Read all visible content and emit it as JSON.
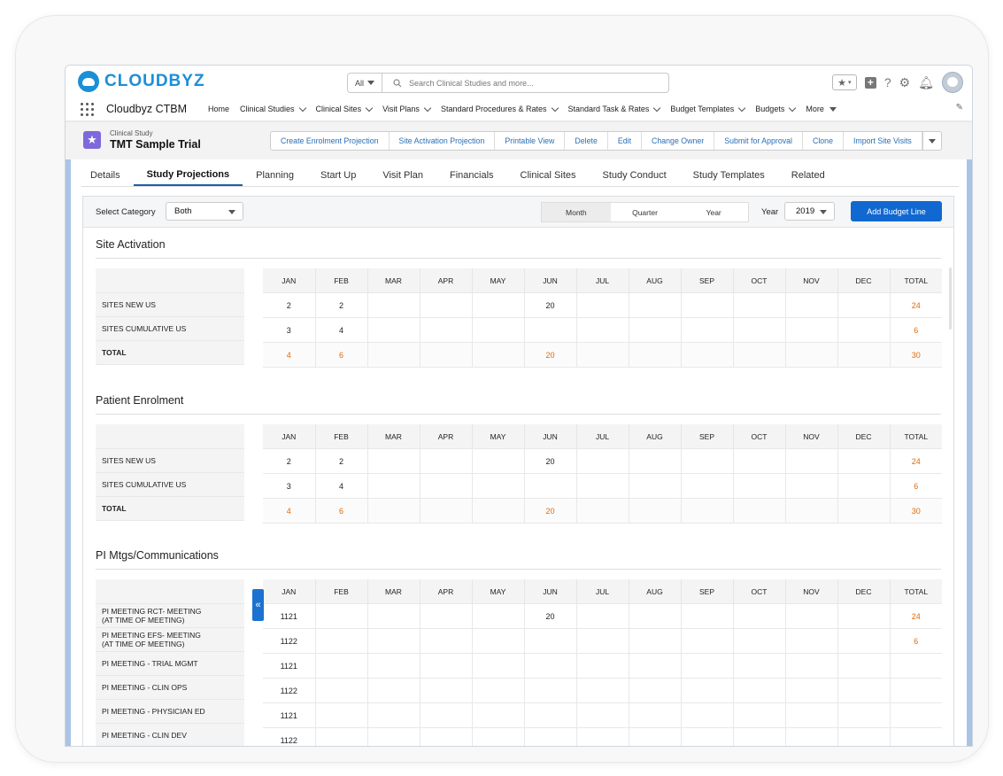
{
  "header": {
    "logo_text": "CLOUDBYZ",
    "search_scope": "All",
    "search_placeholder": "Search Clinical Studies and more..."
  },
  "nav": {
    "app_name": "Cloudbyz CTBM",
    "items": [
      "Home",
      "Clinical Studies",
      "Clinical Sites",
      "Visit Plans",
      "Standard Procedures & Rates",
      "Standard Task & Rates",
      "Budget Templates",
      "Budgets",
      "More"
    ]
  },
  "record": {
    "type": "Clinical Study",
    "name": "TMT Sample Trial",
    "actions": [
      "Create Enrolment Projection",
      "Site Activation Projection",
      "Printable View",
      "Delete",
      "Edit",
      "Change Owner",
      "Submit for Approval",
      "Clone",
      "Import Site Visits"
    ]
  },
  "tabs": [
    "Details",
    "Study Projections",
    "Planning",
    "Start Up",
    "Visit Plan",
    "Financials",
    "Clinical Sites",
    "Study Conduct",
    "Study Templates",
    "Related"
  ],
  "filters": {
    "category_label": "Select Category",
    "category_value": "Both",
    "periods": [
      "Month",
      "Quarter",
      "Year"
    ],
    "year_label": "Year",
    "year_value": "2019",
    "add_button": "Add Budget Line"
  },
  "columns": [
    "JAN",
    "FEB",
    "MAR",
    "APR",
    "MAY",
    "JUN",
    "JUL",
    "AUG",
    "SEP",
    "OCT",
    "NOV",
    "DEC",
    "TOTAL"
  ],
  "sections": [
    {
      "title": "Site Activation",
      "rows": [
        {
          "label": "SITES NEW US",
          "values": [
            "2",
            "2",
            "",
            "",
            "",
            "20",
            "",
            "",
            "",
            "",
            "",
            "",
            "24"
          ]
        },
        {
          "label": "SITES CUMULATIVE US",
          "values": [
            "3",
            "4",
            "",
            "",
            "",
            "",
            "",
            "",
            "",
            "",
            "",
            "",
            "6"
          ]
        },
        {
          "label": "TOTAL",
          "values": [
            "4",
            "6",
            "",
            "",
            "",
            "20",
            "",
            "",
            "",
            "",
            "",
            "",
            "30"
          ]
        }
      ]
    },
    {
      "title": "Patient Enrolment",
      "rows": [
        {
          "label": "SITES NEW US",
          "values": [
            "2",
            "2",
            "",
            "",
            "",
            "20",
            "",
            "",
            "",
            "",
            "",
            "",
            "24"
          ]
        },
        {
          "label": "SITES CUMULATIVE US",
          "values": [
            "3",
            "4",
            "",
            "",
            "",
            "",
            "",
            "",
            "",
            "",
            "",
            "",
            "6"
          ]
        },
        {
          "label": "TOTAL",
          "values": [
            "4",
            "6",
            "",
            "",
            "",
            "20",
            "",
            "",
            "",
            "",
            "",
            "",
            "30"
          ]
        }
      ]
    },
    {
      "title": "PI Mtgs/Communications",
      "rows": [
        {
          "label": "PI MEETING RCT- MEETING",
          "sublabel": "(AT TIME OF MEETING)",
          "values": [
            "1121",
            "",
            "",
            "",
            "",
            "20",
            "",
            "",
            "",
            "",
            "",
            "",
            "24"
          ]
        },
        {
          "label": "PI MEETING EFS- MEETING",
          "sublabel": "(AT TIME OF MEETING)",
          "values": [
            "1122",
            "",
            "",
            "",
            "",
            "",
            "",
            "",
            "",
            "",
            "",
            "",
            "6"
          ]
        },
        {
          "label": "PI MEETING - TRIAL MGMT",
          "values": [
            "1121",
            "",
            "",
            "",
            "",
            "",
            "",
            "",
            "",
            "",
            "",
            "",
            ""
          ]
        },
        {
          "label": "PI MEETING - CLIN OPS",
          "values": [
            "1122",
            "",
            "",
            "",
            "",
            "",
            "",
            "",
            "",
            "",
            "",
            "",
            ""
          ]
        },
        {
          "label": "PI MEETING - PHYSICIAN ED",
          "values": [
            "1121",
            "",
            "",
            "",
            "",
            "",
            "",
            "",
            "",
            "",
            "",
            "",
            ""
          ]
        },
        {
          "label": "PI MEETING - CLIN DEV",
          "values": [
            "1122",
            "",
            "",
            "",
            "",
            "",
            "",
            "",
            "",
            "",
            "",
            "",
            ""
          ]
        }
      ]
    }
  ],
  "colors": {
    "accent": "#1168d0",
    "total_text": "#e06a0b",
    "record_icon": "#7f68dc",
    "logo": "#1b8fd6"
  }
}
